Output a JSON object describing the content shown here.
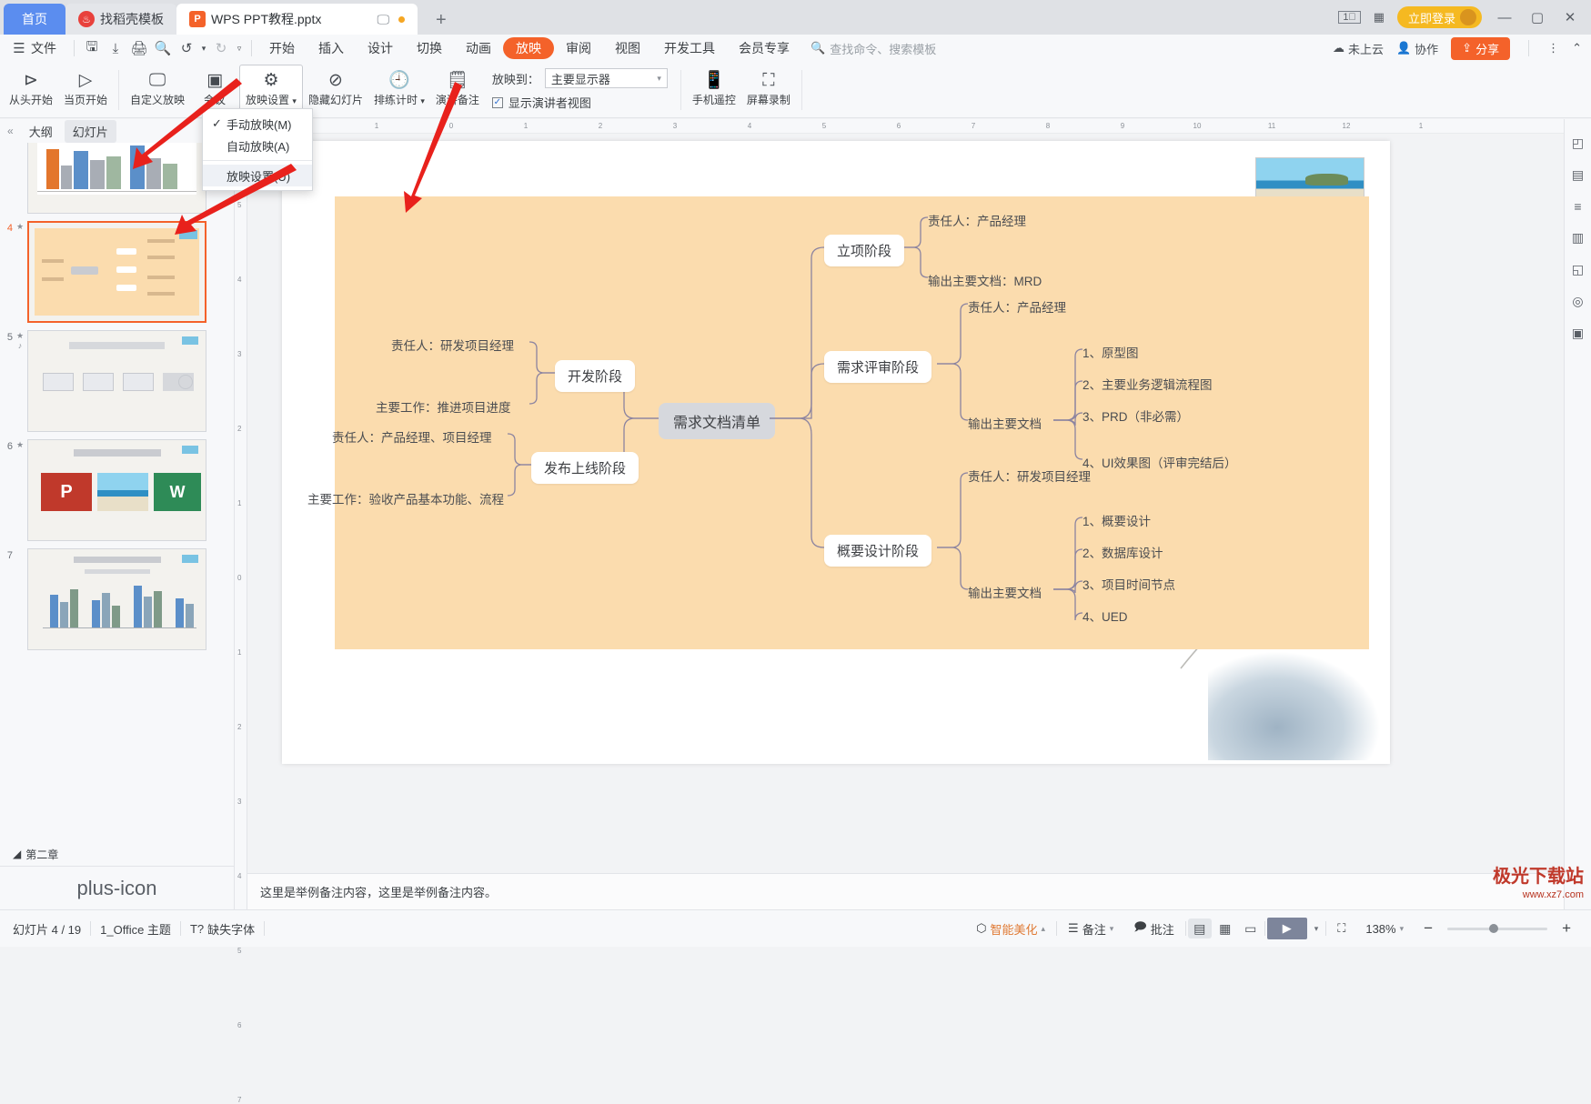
{
  "titlebar": {
    "tabs": [
      {
        "label": "首页",
        "icon": "home-icon"
      },
      {
        "label": "找稻壳模板",
        "icon": "docer-icon"
      },
      {
        "label": "WPS PPT教程.pptx",
        "icon": "ppt-file-icon"
      }
    ],
    "new_tab": "+",
    "page_count_icon": "1",
    "grid_icon": "grid-icon",
    "login_label": "立即登录",
    "minimize": "—",
    "maximize": "▢",
    "close": "✕"
  },
  "menubar": {
    "file_label": "文件",
    "quick_icons": [
      "save-icon",
      "save-as-icon",
      "print-icon",
      "print-preview-icon",
      "undo-icon",
      "redo-icon",
      "customize-icon"
    ],
    "items": [
      "开始",
      "插入",
      "设计",
      "切换",
      "动画",
      "放映",
      "审阅",
      "视图",
      "开发工具",
      "会员专享"
    ],
    "active_item": "放映",
    "search_placeholder": "查找命令、搜索模板",
    "cloud_status": "未上云",
    "collaborate": "协作",
    "share": "分享",
    "more_icon": "more-vertical-icon",
    "collapse_icon": "chevron-up-icon"
  },
  "ribbon": {
    "buttons": [
      {
        "label": "从头开始",
        "icon": "play-from-start-icon"
      },
      {
        "label": "当页开始",
        "icon": "play-from-current-icon"
      },
      {
        "label": "自定义放映",
        "icon": "custom-show-icon"
      },
      {
        "label": "会议",
        "icon": "meeting-icon"
      },
      {
        "label": "放映设置",
        "icon": "show-settings-icon",
        "has_arrow": true,
        "active": true
      },
      {
        "label": "隐藏幻灯片",
        "icon": "hide-slide-icon"
      },
      {
        "label": "排练计时",
        "icon": "rehearse-timing-icon",
        "has_arrow": true
      },
      {
        "label": "演讲备注",
        "icon": "presenter-notes-icon"
      }
    ],
    "project_to_label": "放映到：",
    "project_to_value": "主要显示器",
    "presenter_view_label": "显示演讲者视图",
    "presenter_view_checked": true,
    "right_buttons": [
      {
        "label": "手机遥控",
        "icon": "phone-remote-icon"
      },
      {
        "label": "屏幕录制",
        "icon": "screen-record-icon"
      }
    ]
  },
  "dropdown": {
    "items": [
      {
        "label": "手动放映(M)",
        "checked": true
      },
      {
        "label": "自动放映(A)",
        "checked": false
      },
      {
        "label": "放映设置(U)",
        "checked": false,
        "highlighted": true
      }
    ]
  },
  "leftpane": {
    "collapse_icon": "collapse-icon",
    "tabs": [
      {
        "label": "大纲",
        "selected": false
      },
      {
        "label": "幻灯片",
        "selected": true
      }
    ],
    "slides": [
      {
        "number": "",
        "type": "chart",
        "selected": false
      },
      {
        "number": "4",
        "type": "mindmap",
        "selected": true
      },
      {
        "number": "5",
        "type": "process",
        "selected": false
      },
      {
        "number": "6",
        "type": "images",
        "selected": false
      },
      {
        "number": "7",
        "type": "chart2",
        "selected": false
      }
    ],
    "chapter_label": "第二章",
    "add_slide_icon": "plus-icon"
  },
  "slide": {
    "background_color": "#fbdcae",
    "photo_caption": "beach-photo",
    "mindmap": {
      "center": "需求文档清单",
      "left_branches": [
        {
          "title": "开发阶段",
          "items": [
            "责任人：研发项目经理",
            "主要工作：推进项目进度"
          ]
        },
        {
          "title": "发布上线阶段",
          "items": [
            "责任人：产品经理、项目经理",
            "主要工作：验收产品基本功能、流程"
          ]
        }
      ],
      "right_branches": [
        {
          "title": "立项阶段",
          "items": [
            {
              "label": "责任人：产品经理",
              "children": []
            },
            {
              "label": "输出主要文档：MRD",
              "children": []
            }
          ]
        },
        {
          "title": "需求评审阶段",
          "items": [
            {
              "label": "责任人：产品经理",
              "children": []
            },
            {
              "label": "输出主要文档",
              "children": [
                "1、原型图",
                "2、主要业务逻辑流程图",
                "3、PRD（非必需）",
                "4、UI效果图（评审完结后）"
              ]
            }
          ]
        },
        {
          "title": "概要设计阶段",
          "items": [
            {
              "label": "责任人：研发项目经理",
              "children": []
            },
            {
              "label": "输出主要文档",
              "children": [
                "1、概要设计",
                "2、数据库设计",
                "3、项目时间节点",
                "4、UED"
              ]
            }
          ]
        }
      ]
    }
  },
  "rulers": {
    "horizontal": [
      "2",
      "1",
      "0",
      "1",
      "2",
      "3",
      "4",
      "5",
      "6",
      "7",
      "8",
      "9",
      "10",
      "11",
      "12",
      "1"
    ],
    "vertical": [
      "5",
      "4",
      "3",
      "2",
      "1",
      "0",
      "1",
      "2",
      "3",
      "4",
      "5",
      "6",
      "7"
    ]
  },
  "notes": {
    "text": "这里是举例备注内容，这里是举例备注内容。"
  },
  "rightbar": {
    "icons": [
      "shapes-icon",
      "format-icon",
      "align-icon",
      "chart-panel-icon",
      "layers-icon",
      "design-ideas-icon",
      "library-icon"
    ]
  },
  "statusbar": {
    "slide_info": "幻灯片 4 / 19",
    "theme": "1_Office 主题",
    "missing_font": "缺失字体",
    "beautify": "智能美化",
    "notes_btn": "备注",
    "comment_btn": "批注",
    "zoom_value": "138%",
    "zoom_out": "−",
    "zoom_in": "+",
    "view_normal_icon": "normal-view-icon",
    "view_sorter_icon": "slide-sorter-icon",
    "view_reading_icon": "reading-view-icon",
    "play_icon": "play-icon",
    "fit_icon": "fit-to-window-icon"
  },
  "watermark": {
    "line1": "极光下载站",
    "line2": "www.xz7.com"
  }
}
